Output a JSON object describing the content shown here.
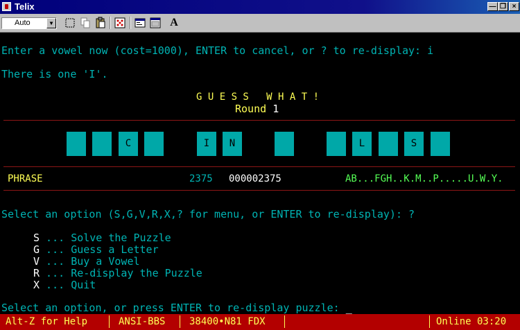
{
  "window": {
    "title": "Telix"
  },
  "toolbar": {
    "emulation_combo": "Auto",
    "font_button": "A"
  },
  "terminal": {
    "prompt_vowel": "Enter a vowel now (cost=1000), ENTER to cancel, or ? to re-display: i",
    "result_line": "There is one 'I'.",
    "game_title": "G U E S S   W H A T !",
    "round_label": "Round ",
    "round_number": "1",
    "tiles": [
      "",
      "",
      "C",
      "",
      "I",
      "N",
      "",
      "",
      "L",
      "",
      "S",
      ""
    ],
    "category": "PHRASE",
    "round_score": "2375",
    "total_score": "000002375",
    "letters_used": "AB...FGH..K.M..P.....U.W.Y.",
    "select_prompt": "Select an option (S,G,V,R,X,? for menu, or ENTER to re-display): ?",
    "menu": [
      {
        "key": "S",
        "label": "Solve the Puzzle"
      },
      {
        "key": "G",
        "label": "Guess a Letter"
      },
      {
        "key": "V",
        "label": "Buy a Vowel"
      },
      {
        "key": "R",
        "label": "Re-display the Puzzle"
      },
      {
        "key": "X",
        "label": "Quit"
      }
    ],
    "bottom_prompt": "Select an option, or press ENTER to re-display puzzle: ",
    "cursor": "_"
  },
  "status": {
    "help": "Alt-Z for Help",
    "emulation": "ANSI-BBS",
    "connection": "38400•N81 FDX",
    "online": "Online 03:20"
  },
  "colors": {
    "terminal_bg": "#000000",
    "text_cyan": "#00b4b4",
    "text_yellow": "#ffff55",
    "text_green": "#55ff55",
    "tile_cyan": "#00a8a8",
    "rule_red": "#8e1616",
    "status_red": "#b30000",
    "titlebar_blue": "#00007b"
  }
}
